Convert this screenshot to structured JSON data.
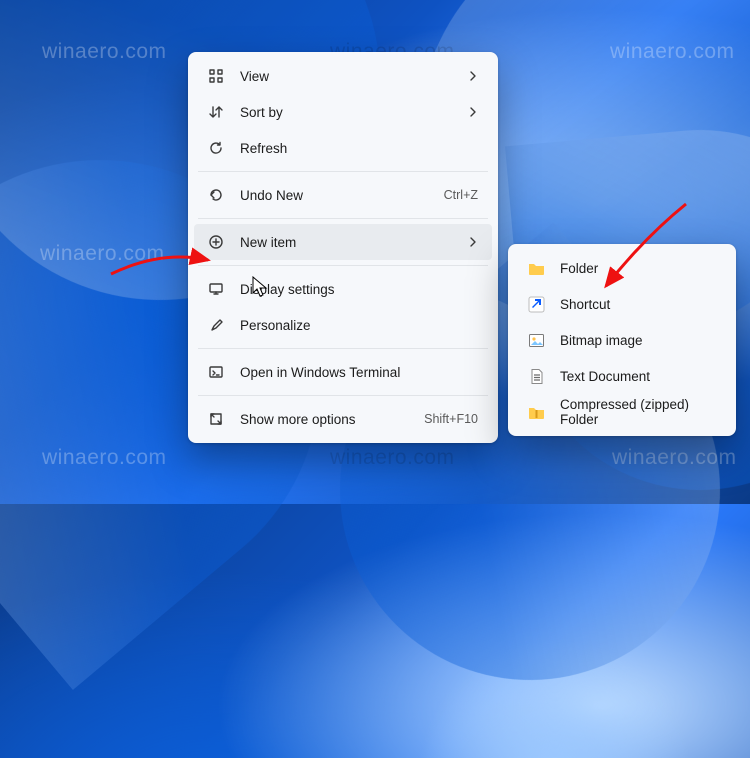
{
  "watermark": "winaero.com",
  "main_menu": {
    "view": {
      "label": "View"
    },
    "sort_by": {
      "label": "Sort by"
    },
    "refresh": {
      "label": "Refresh"
    },
    "undo": {
      "label": "Undo New",
      "shortcut": "Ctrl+Z"
    },
    "new_item": {
      "label": "New item"
    },
    "display": {
      "label": "Display settings"
    },
    "personalize": {
      "label": "Personalize"
    },
    "terminal": {
      "label": "Open in Windows Terminal"
    },
    "more": {
      "label": "Show more options",
      "shortcut": "Shift+F10"
    }
  },
  "sub_menu": {
    "folder": {
      "label": "Folder"
    },
    "shortcut": {
      "label": "Shortcut"
    },
    "bitmap": {
      "label": "Bitmap image"
    },
    "text": {
      "label": "Text Document"
    },
    "zip": {
      "label": "Compressed (zipped) Folder"
    }
  }
}
